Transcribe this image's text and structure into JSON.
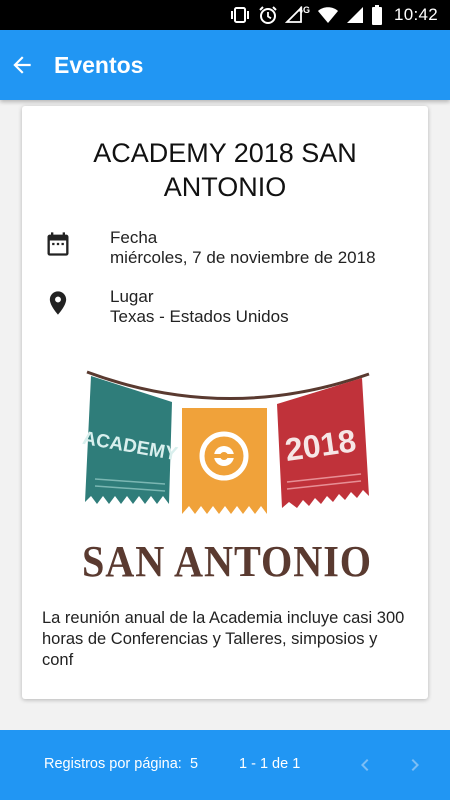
{
  "status_bar": {
    "time": "10:42",
    "network": "4G",
    "icons": [
      "vibrate-icon",
      "alarm-icon",
      "signal-4g-icon",
      "wifi-icon",
      "signal-icon",
      "battery-icon"
    ]
  },
  "app_bar": {
    "title": "Eventos",
    "background": "#2196f3",
    "back_icon": "arrow-back-icon"
  },
  "event": {
    "title": "ACADEMY 2018 SAN ANTONIO",
    "date_label": "Fecha",
    "date_value": "miércoles, 7 de noviembre de 2018",
    "place_label": "Lugar",
    "place_value": "Texas - Estados Unidos",
    "logo": {
      "banner_texts": [
        "ACADEMY",
        "2018"
      ],
      "caption": "SAN ANTONIO",
      "colors": {
        "teal": "#2f7d7a",
        "orange": "#f0a23a",
        "red": "#c0323a",
        "brown": "#5a3a30"
      }
    },
    "description": "La reunión anual de la Academia incluye casi 300 horas de Conferencias y Talleres, simposios y conf"
  },
  "pagination": {
    "rows_per_page_label": "Registros por página:",
    "rows_per_page_value": "5",
    "range_text": "1 - 1 de 1",
    "prev_icon": "chevron-left-icon",
    "next_icon": "chevron-right-icon"
  }
}
